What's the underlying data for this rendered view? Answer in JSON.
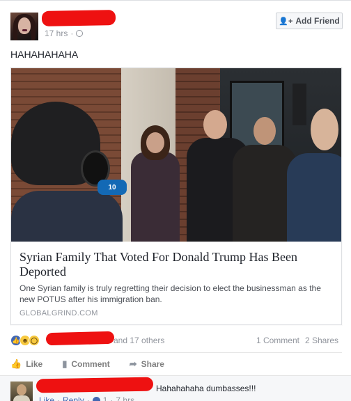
{
  "post": {
    "timestamp": "17 hrs",
    "separator": "·",
    "privacy_icon": "globe-icon",
    "text": "HAHAHAHAHA",
    "add_friend_label": "Add Friend"
  },
  "link": {
    "headline": "Syrian Family That Voted For Donald Trump Has Been Deported",
    "description": "One Syrian family is truly regretting their decision to elect the businessman as the new POTUS after his immigration ban.",
    "domain": "GLOBALGRIND.COM",
    "mic_flag_text": "10"
  },
  "engagement": {
    "reaction_icons": [
      "like-icon",
      "haha-icon",
      "wow-icon"
    ],
    "others_text": "and 17 others",
    "comments_count": "1 Comment",
    "shares_count": "2 Shares"
  },
  "actions": {
    "like": "Like",
    "comment": "Comment",
    "share": "Share"
  },
  "comment": {
    "text": "Hahahahaha dumbasses!!!",
    "like_link": "Like",
    "reply_link": "Reply",
    "like_count": "1",
    "time": "7 hrs",
    "dot": "·"
  },
  "colors": {
    "redaction": "#ee1111",
    "facebook_blue": "#4267b2",
    "muted_text": "#90949c"
  }
}
